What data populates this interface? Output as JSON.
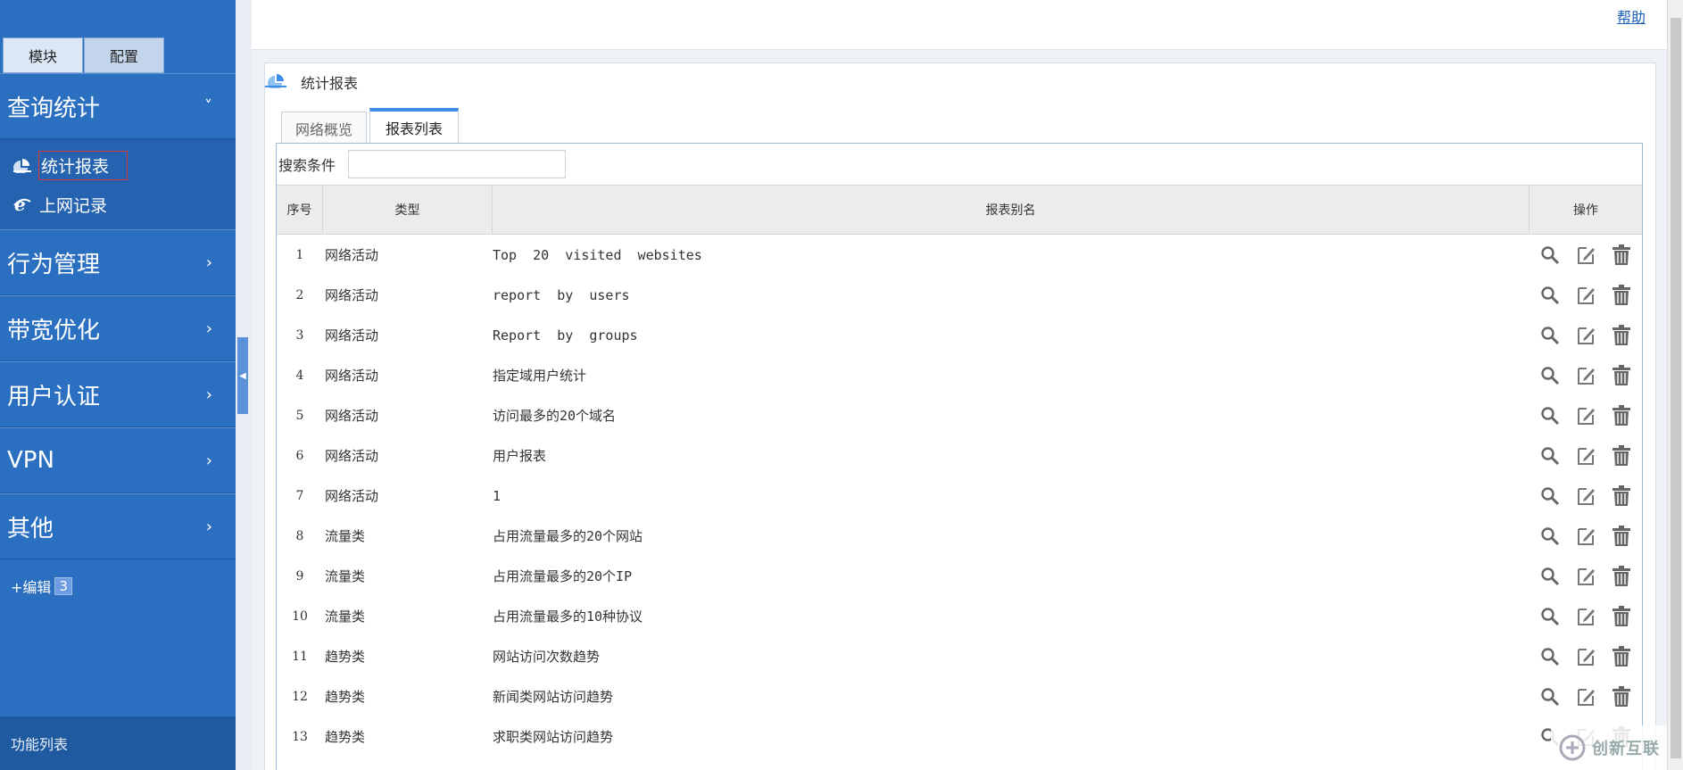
{
  "top_tabs": {
    "module": "模块",
    "config": "配置"
  },
  "sidebar": {
    "sections": [
      {
        "label": "查询统计",
        "chevron": "˅"
      },
      {
        "label": "行为管理",
        "chevron": "›"
      },
      {
        "label": "带宽优化",
        "chevron": "›"
      },
      {
        "label": "用户认证",
        "chevron": "›"
      },
      {
        "label": "VPN",
        "chevron": "›"
      },
      {
        "label": "其他",
        "chevron": "›"
      }
    ],
    "sub_items": [
      {
        "label": "统计报表",
        "icon": "pie-chart-icon"
      },
      {
        "label": "上网记录",
        "icon": "ie-browser-icon"
      }
    ],
    "edit_label": "+编辑",
    "edit_count": "3",
    "func_list": "功能列表"
  },
  "header": {
    "help": "帮助"
  },
  "panel": {
    "title": "统计报表",
    "tabs": [
      {
        "label": "网络概览"
      },
      {
        "label": "报表列表"
      }
    ],
    "search_label": "搜索条件",
    "search_value": "",
    "columns": [
      "序号",
      "类型",
      "报表别名",
      "操作"
    ],
    "rows": [
      {
        "no": "1",
        "type": "网络活动",
        "alias": "Top  20  visited  websites"
      },
      {
        "no": "2",
        "type": "网络活动",
        "alias": "report  by  users"
      },
      {
        "no": "3",
        "type": "网络活动",
        "alias": "Report  by  groups"
      },
      {
        "no": "4",
        "type": "网络活动",
        "alias": "指定域用户统计"
      },
      {
        "no": "5",
        "type": "网络活动",
        "alias": "访问最多的20个域名"
      },
      {
        "no": "6",
        "type": "网络活动",
        "alias": "用户报表"
      },
      {
        "no": "7",
        "type": "网络活动",
        "alias": "1"
      },
      {
        "no": "8",
        "type": "流量类",
        "alias": "占用流量最多的20个网站"
      },
      {
        "no": "9",
        "type": "流量类",
        "alias": "占用流量最多的20个IP"
      },
      {
        "no": "10",
        "type": "流量类",
        "alias": "占用流量最多的10种协议"
      },
      {
        "no": "11",
        "type": "趋势类",
        "alias": "网站访问次数趋势"
      },
      {
        "no": "12",
        "type": "趋势类",
        "alias": "新闻类网站访问趋势"
      },
      {
        "no": "13",
        "type": "趋势类",
        "alias": "求职类网站访问趋势"
      }
    ],
    "row_actions": [
      "search-icon",
      "edit-icon",
      "trash-icon"
    ]
  },
  "watermark": {
    "text": "创新互联"
  }
}
